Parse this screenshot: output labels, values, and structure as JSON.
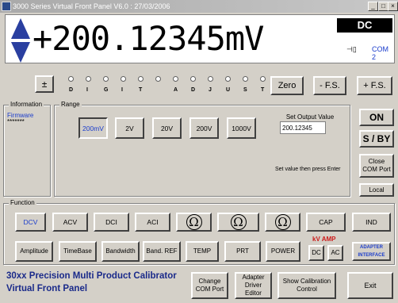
{
  "window": {
    "title": "3000 Series Virtual Front Panel V6.0 : 27/03/2006"
  },
  "display": {
    "value": "+200.12345mV",
    "mode": "DC",
    "port": "COM 2"
  },
  "controls": {
    "plusminus": "±",
    "digit_adjust": [
      "D",
      "I",
      "G",
      "I",
      "T",
      "",
      "A",
      "D",
      "J",
      "U",
      "S",
      "T"
    ],
    "zero": "Zero",
    "minus_fs": "- F.S.",
    "plus_fs": "+ F.S."
  },
  "information": {
    "legend": "Information",
    "firmware_label": "Firmware",
    "firmware_value": "*******"
  },
  "range": {
    "legend": "Range",
    "items": [
      "200mV",
      "2V",
      "20V",
      "200V",
      "1000V"
    ],
    "selected": "200mV"
  },
  "output": {
    "label": "Set Output Value",
    "value": "200.12345",
    "hint": "Set value then press Enter"
  },
  "side": {
    "on": "ON",
    "sby": "S / BY",
    "close": "Close COM Port",
    "local": "Local"
  },
  "function": {
    "legend": "Function",
    "row1": [
      "DCV",
      "ACV",
      "DCI",
      "ACI",
      "Ω2",
      "Ω4",
      "Ω6",
      "CAP",
      "IND"
    ],
    "row2": [
      "Amplitude",
      "TimeBase",
      "Bandwidth",
      "Band. REF",
      "TEMP",
      "PRT",
      "POWER"
    ],
    "kv_amp": "kV AMP",
    "dc": "DC",
    "ac": "AC",
    "adapter": "ADAPTER INTERFACE"
  },
  "footer": {
    "line1": "30xx Precision Multi Product Calibrator",
    "line2": "Virtual Front Panel",
    "change_com": "Change COM Port",
    "adapter_editor": "Adapter Driver Editor",
    "show_cal": "Show Calibration Control",
    "exit": "Exit"
  },
  "colors": {
    "accent": "#1a3ccc",
    "arrows": "#2a3fa0"
  }
}
